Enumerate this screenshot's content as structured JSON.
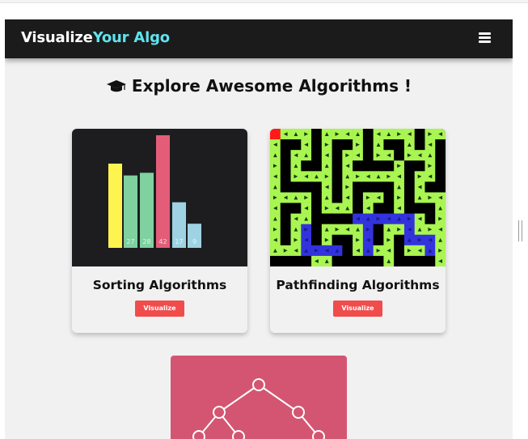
{
  "app": {
    "brand_white": "Visualize",
    "brand_cyan": "Your Algo",
    "menu_icon": "hamburger-icon"
  },
  "heading": {
    "icon": "graduation-cap-icon",
    "text": "Explore Awesome Algorithms !"
  },
  "cards": [
    {
      "title": "Sorting Algorithms",
      "button": "Visualize",
      "image": {
        "bar_values": [
          null,
          27,
          28,
          42,
          17,
          9
        ],
        "bar_labels": [
          "",
          "27",
          "28",
          "42",
          "17",
          "9"
        ],
        "bar_colors": [
          "#fff44f",
          "#7fd19f",
          "#7fd19f",
          "#e35d78",
          "#9fd3e3",
          "#9fd3e3"
        ]
      }
    },
    {
      "title": "Pathfinding Algorithms",
      "button": "Visualize",
      "image": {
        "wall_color": "#000000",
        "visited_color": "#a9f551",
        "path_color": "#3333dd",
        "start_color": "#ff1a1a"
      }
    },
    {
      "title": "",
      "image": {
        "background": "#d45571",
        "node_color": "#ffffff"
      }
    }
  ]
}
